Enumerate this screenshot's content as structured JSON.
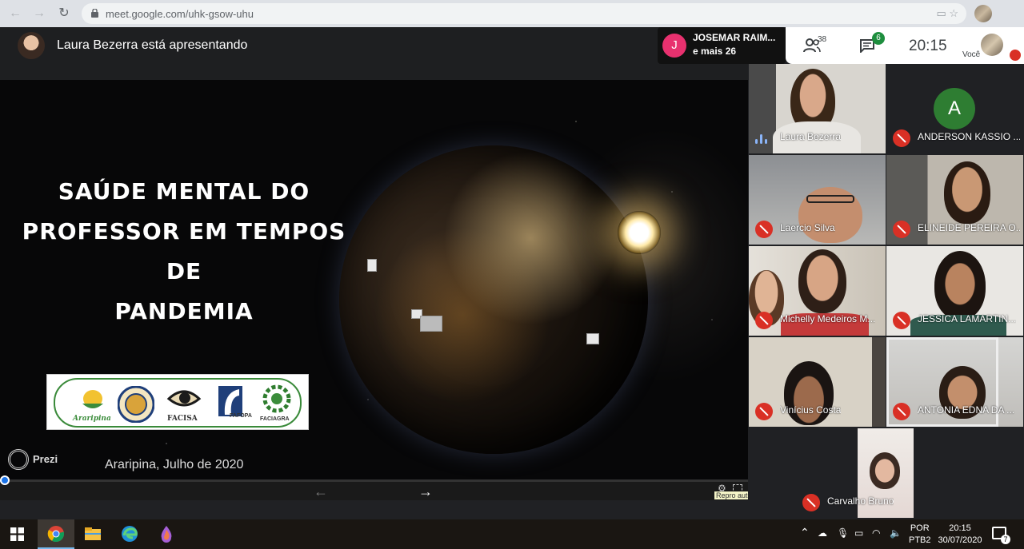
{
  "browser": {
    "url": "meet.google.com/uhk-gsow-uhu"
  },
  "meet": {
    "presenter_text": "Laura Bezerra está apresentando",
    "speaker": {
      "initial": "J",
      "name": "JOSEMAR RAIM...",
      "more": "e mais 26"
    },
    "panel": {
      "people_count": "38",
      "chat_count": "6",
      "time": "20:15",
      "self_label": "Você"
    }
  },
  "slide": {
    "title_lines": [
      "SAÚDE MENTAL DO",
      "PROFESSOR EM TEMPOS DE",
      "PANDEMIA"
    ],
    "logos": [
      "Araripina",
      "FACISA",
      "FAFOPA",
      "FACIAGRA"
    ],
    "prezi_label": "Prezi",
    "place_date": "Araripina, Julho de 2020",
    "progress": 0.005,
    "repro_tooltip": "Repro auto"
  },
  "participants": [
    {
      "name": "Laura Bezerra",
      "muted": false,
      "speaking": true
    },
    {
      "name": "ANDERSON KASSIO ...",
      "muted": true,
      "initial": "A"
    },
    {
      "name": "Laercio Silva",
      "muted": true
    },
    {
      "name": "ELINEIDE PEREIRA O...",
      "muted": true
    },
    {
      "name": "Michelly Medeiros M...",
      "muted": true
    },
    {
      "name": "JESSICA LAMARTIN...",
      "muted": true
    },
    {
      "name": "Vinícius Costa",
      "muted": true
    },
    {
      "name": "ANTONIA EDNA DA ...",
      "muted": true
    },
    {
      "name": "Carvalho Bruno",
      "muted": true
    }
  ],
  "taskbar": {
    "apps": [
      "start-icon",
      "chrome-icon",
      "file-explorer-icon",
      "edge-icon",
      "paint-3d-icon"
    ],
    "lang_line1": "POR",
    "lang_line2": "PTB2",
    "clock_time": "20:15",
    "clock_date": "30/07/2020",
    "notification_count": "7"
  },
  "colors": {
    "muted_red": "#d93025",
    "accent_blue": "#1a73e8",
    "chat_badge_green": "#1e8e3e",
    "speaker_pink": "#e8316f"
  }
}
